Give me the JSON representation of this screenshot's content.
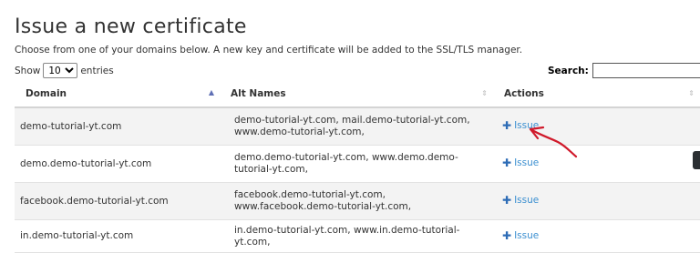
{
  "page": {
    "title": "Issue a new certificate",
    "description": "Choose from one of your domains below. A new key and certificate will be added to the SSL/TLS manager."
  },
  "controls": {
    "show_label": "Show",
    "show_value": "10",
    "entries_label": "entries",
    "search_label": "Search:",
    "search_value": ""
  },
  "table": {
    "headers": {
      "domain": "Domain",
      "alt_names": "Alt Names",
      "actions": "Actions"
    },
    "rows": [
      {
        "domain": "demo-tutorial-yt.com",
        "alt_names": "demo-tutorial-yt.com, mail.demo-tutorial-yt.com, www.demo-tutorial-yt.com,",
        "action": "Issue"
      },
      {
        "domain": "demo.demo-tutorial-yt.com",
        "alt_names": "demo.demo-tutorial-yt.com, www.demo.demo-tutorial-yt.com,",
        "action": "Issue"
      },
      {
        "domain": "facebook.demo-tutorial-yt.com",
        "alt_names": "facebook.demo-tutorial-yt.com, www.facebook.demo-tutorial-yt.com,",
        "action": "Issue"
      },
      {
        "domain": "in.demo-tutorial-yt.com",
        "alt_names": "in.demo-tutorial-yt.com, www.in.demo-tutorial-yt.com,",
        "action": "Issue"
      }
    ]
  },
  "icons": {
    "plus": "plus-icon",
    "sort_asc": "sort-ascending-icon",
    "sort_both": "sort-both-icon"
  },
  "colors": {
    "link": "#3b8fd0",
    "annotation": "#d0192a",
    "row_alt": "#f3f3f3"
  }
}
